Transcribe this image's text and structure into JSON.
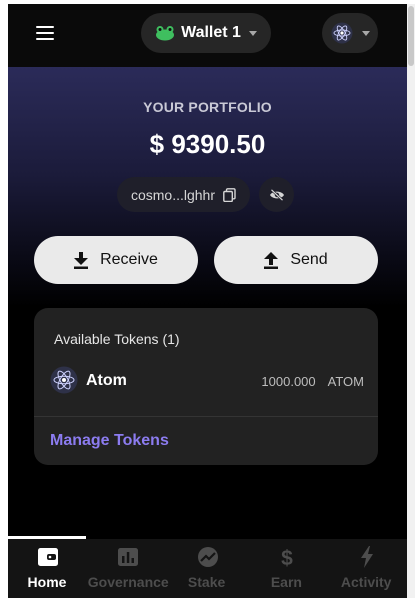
{
  "header": {
    "wallet_name": "Wallet 1",
    "wallet_avatar_icon": "frog-icon",
    "network_icon": "cosmos-atom-icon"
  },
  "portfolio": {
    "label": "YOUR PORTFOLIO",
    "value": "$ 9390.50",
    "address": "cosmo...lghhr"
  },
  "actions": {
    "receive_label": "Receive",
    "send_label": "Send"
  },
  "tokens": {
    "title": "Available Tokens (1)",
    "items": [
      {
        "name": "Atom",
        "balance": "1000.000",
        "symbol": "ATOM"
      }
    ],
    "manage_label": "Manage Tokens"
  },
  "nav": {
    "items": [
      {
        "label": "Home",
        "icon": "wallet-icon"
      },
      {
        "label": "Governance",
        "icon": "bar-chart-icon"
      },
      {
        "label": "Stake",
        "icon": "stake-icon"
      },
      {
        "label": "Earn",
        "icon": "dollar-icon"
      },
      {
        "label": "Activity",
        "icon": "lightning-icon"
      }
    ]
  },
  "colors": {
    "accent": "#8c7cf0",
    "background": "#000000",
    "card": "#222222"
  }
}
